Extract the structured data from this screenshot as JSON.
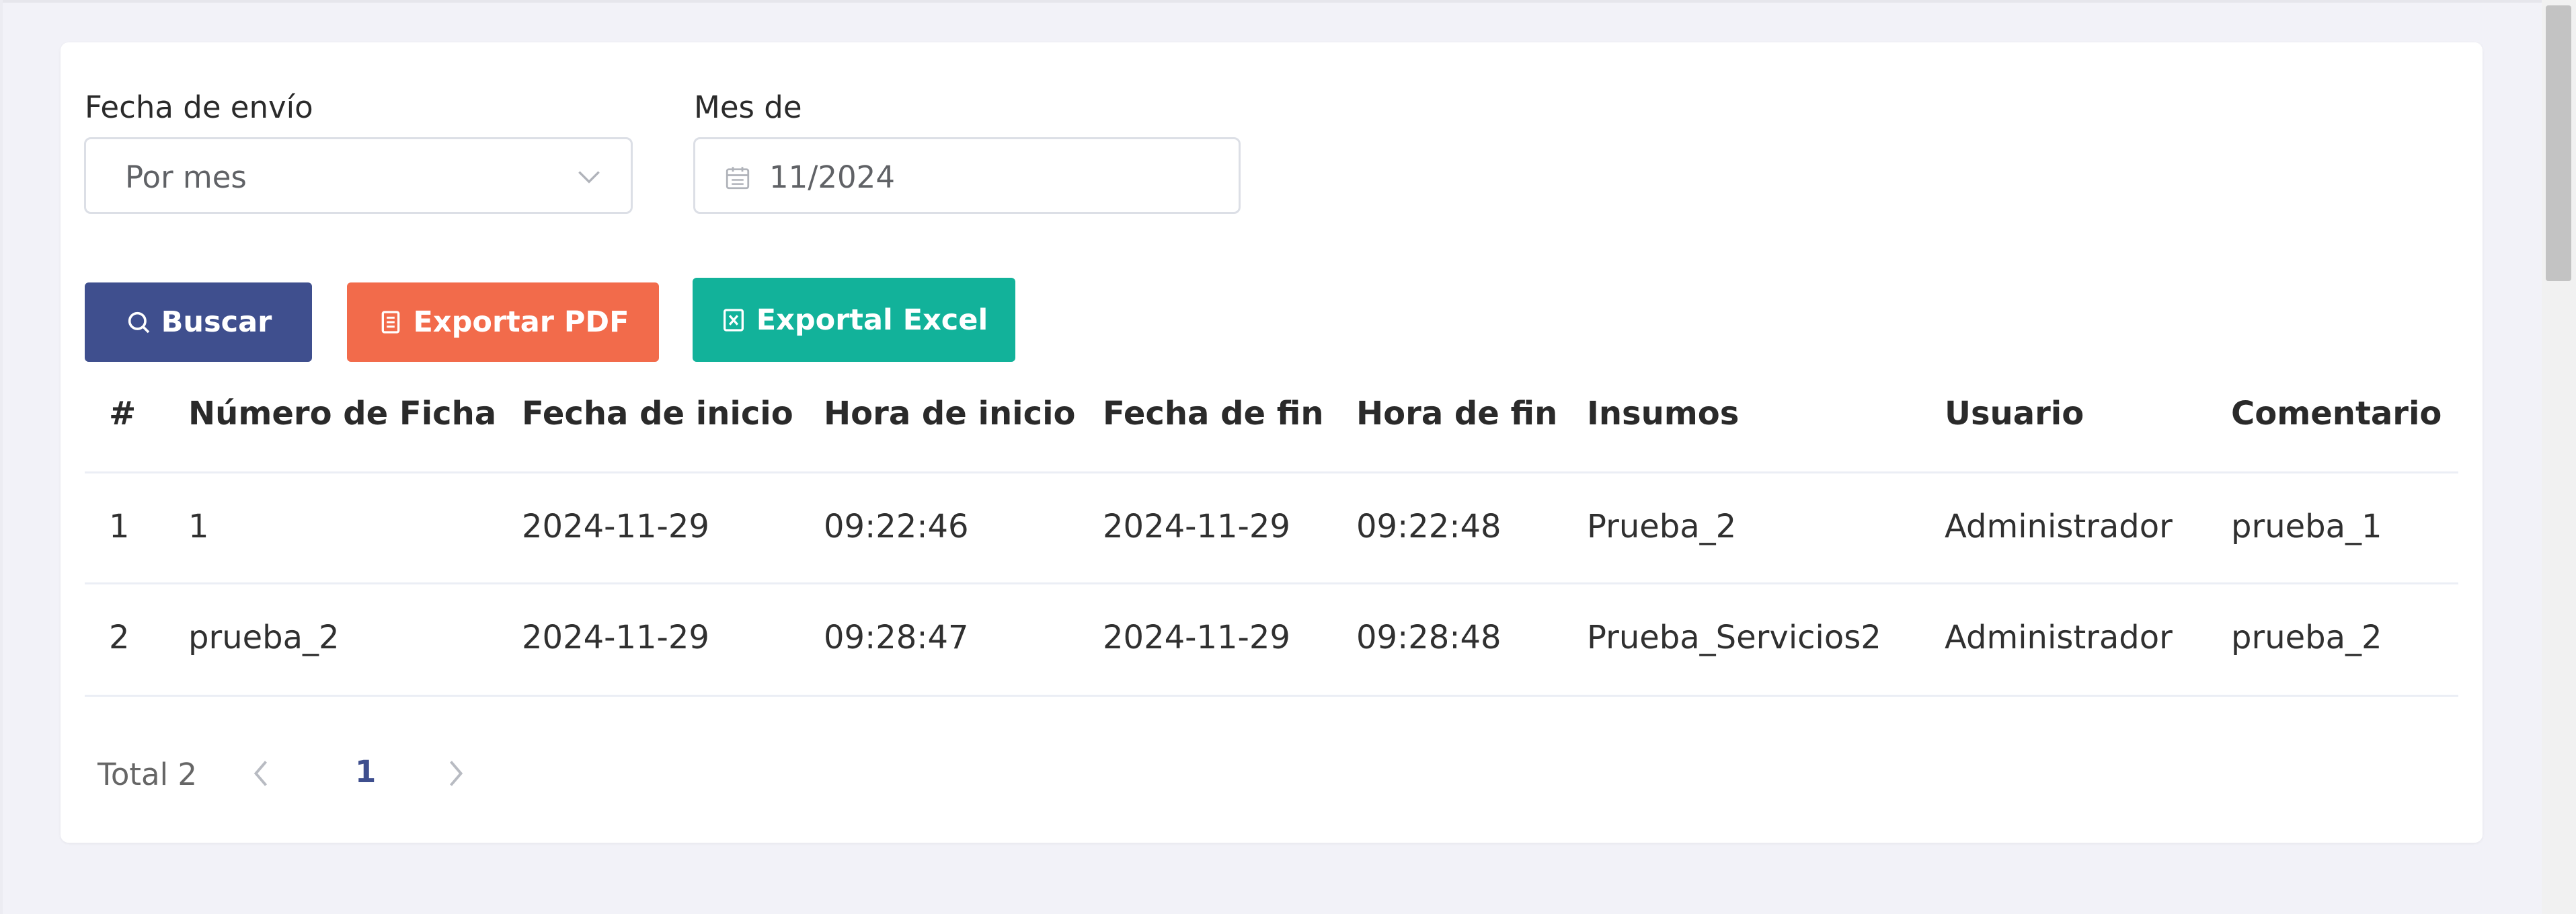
{
  "filters": {
    "send_date_label": "Fecha de envío",
    "send_date_value": "Por mes",
    "month_label": "Mes de",
    "month_value": "11/2024"
  },
  "actions": {
    "search": "Buscar",
    "export_pdf": "Exportar PDF",
    "export_excel": "Exportal Excel"
  },
  "table": {
    "columns": [
      "#",
      "Número de Ficha",
      "Fecha de inicio",
      "Hora de inicio",
      "Fecha de fin",
      "Hora de fin",
      "Insumos",
      "Usuario",
      "Comentario"
    ],
    "rows": [
      [
        "1",
        "1",
        "2024-11-29",
        "09:22:46",
        "2024-11-29",
        "09:22:48",
        "Prueba_2",
        "Administrador",
        "prueba_1"
      ],
      [
        "2",
        "prueba_2",
        "2024-11-29",
        "09:28:47",
        "2024-11-29",
        "09:28:48",
        "Prueba_Servicios2",
        "Administrador",
        "prueba_2"
      ]
    ]
  },
  "pagination": {
    "total": "Total 2",
    "current_page": "1"
  },
  "colors": {
    "primary": "#3f4f8e",
    "pdf": "#f26b4b",
    "excel": "#12b29a"
  }
}
